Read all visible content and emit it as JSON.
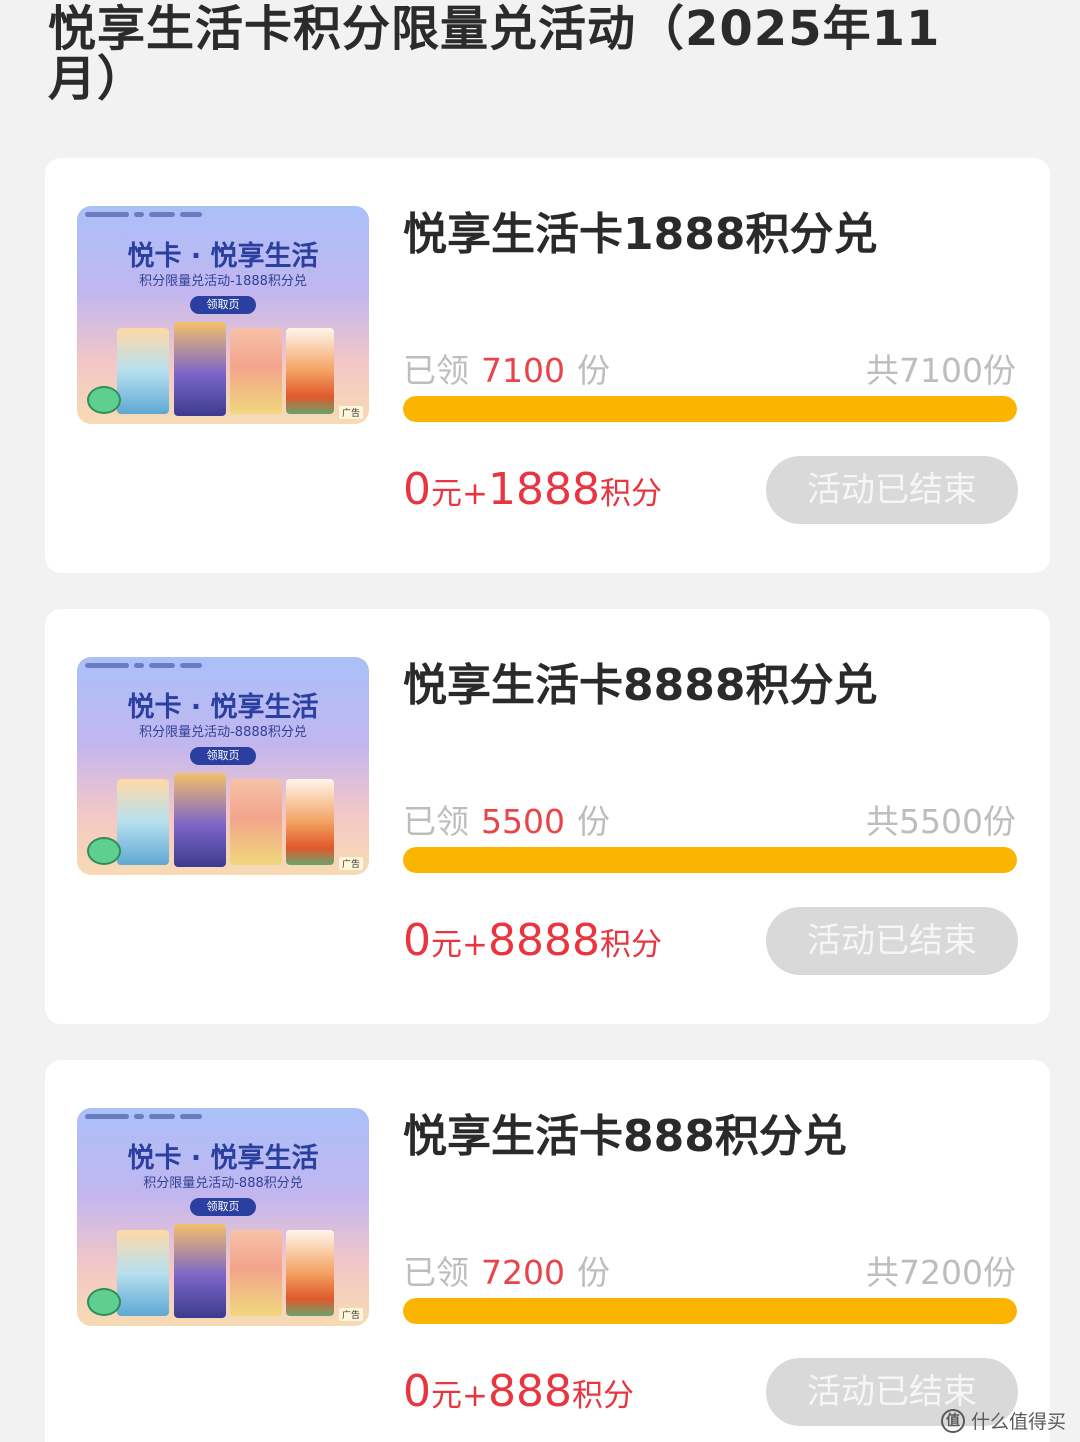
{
  "page_title": "悦享生活卡积分限量兑活动（2025年11月）",
  "labels": {
    "claimed_prefix": "已领",
    "claimed_suffix": "份"
  },
  "thumbnail": {
    "heading": "悦卡 · 悦享生活",
    "badge": "领取页",
    "brand_tag": "广告"
  },
  "items": [
    {
      "title": "悦享生活卡1888积分兑",
      "thumb_sub": "积分限量兑活动-1888积分兑",
      "claimed": "7100",
      "total": "共7100份",
      "progress": 1.0,
      "price_yuan": "0",
      "price_unit": "元+",
      "points": "1888",
      "points_unit": "积分",
      "button": "活动已结束"
    },
    {
      "title": "悦享生活卡8888积分兑",
      "thumb_sub": "积分限量兑活动-8888积分兑",
      "claimed": "5500",
      "total": "共5500份",
      "progress": 1.0,
      "price_yuan": "0",
      "price_unit": "元+",
      "points": "8888",
      "points_unit": "积分",
      "button": "活动已结束"
    },
    {
      "title": "悦享生活卡888积分兑",
      "thumb_sub": "积分限量兑活动-888积分兑",
      "claimed": "7200",
      "total": "共7200份",
      "progress": 1.0,
      "price_yuan": "0",
      "price_unit": "元+",
      "points": "888",
      "points_unit": "积分",
      "button": "活动已结束"
    }
  ],
  "watermark": {
    "icon": "值",
    "text": "什么值得买"
  },
  "colors": {
    "accent_red": "#e8353f",
    "progress_yellow": "#fbb500",
    "ended_button": "#d9d9d9"
  }
}
